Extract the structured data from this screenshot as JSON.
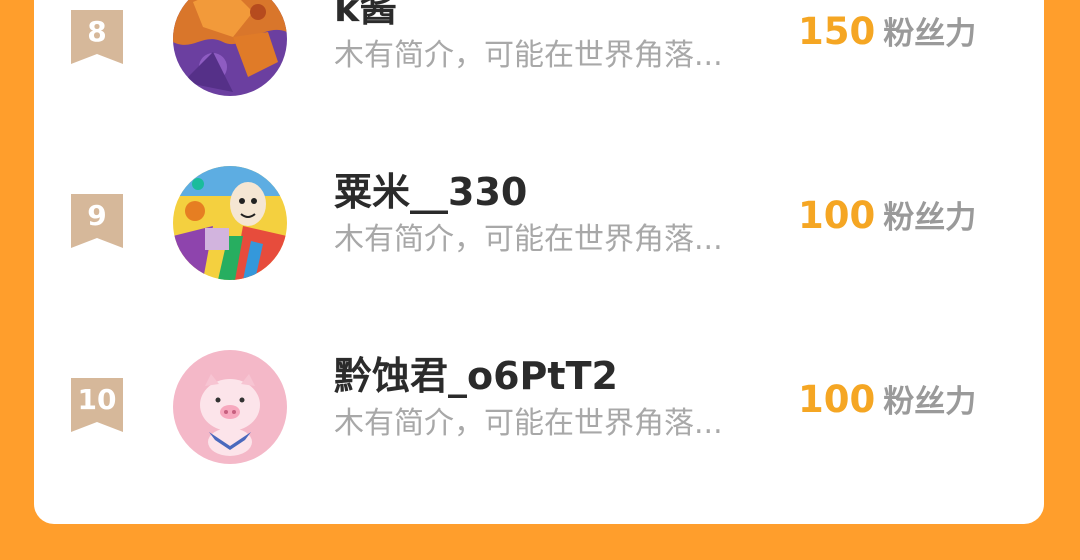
{
  "ranking": {
    "rows": [
      {
        "rank": "8",
        "name": "k酱",
        "bio": "木有简介，可能在世界角落...",
        "fans_value": "150",
        "fans_label": "粉丝力",
        "avatar_icon": "fox-avatar-icon"
      },
      {
        "rank": "9",
        "name": "粟米__330",
        "bio": "木有简介，可能在世界角落...",
        "fans_value": "100",
        "fans_label": "粉丝力",
        "avatar_icon": "colorful-art-avatar-icon"
      },
      {
        "rank": "10",
        "name": "黔蚀君_o6PtT2",
        "bio": "木有简介，可能在世界角落...",
        "fans_value": "100",
        "fans_label": "粉丝力",
        "avatar_icon": "pig-avatar-icon"
      }
    ]
  },
  "colors": {
    "page_background": "#FF9E2C",
    "card_background": "#FFFFFF",
    "fans_value": "#F5A623",
    "rank_badge": "#D6B89A"
  }
}
